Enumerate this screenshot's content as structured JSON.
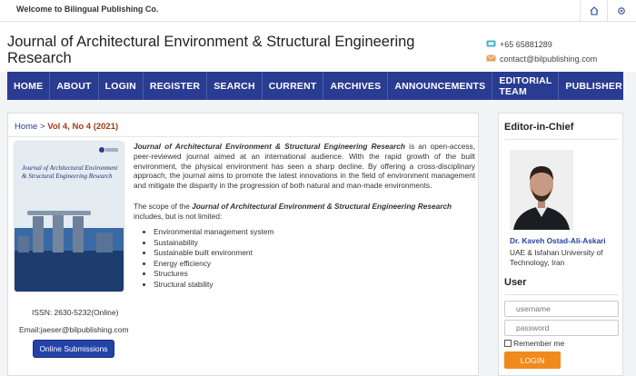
{
  "topbar": {
    "welcome": "Welcome to Bilingual Publishing Co.",
    "icons": [
      "home-icon",
      "gear-icon"
    ]
  },
  "header": {
    "journal_title": "Journal of Architectural Environment & Structural Engineering Research",
    "phone": "+65 65881289",
    "email": "contact@bilpublishing.com",
    "phone_icon": "phone-icon",
    "mail_icon": "mail-icon"
  },
  "nav": [
    "HOME",
    "ABOUT",
    "LOGIN",
    "REGISTER",
    "SEARCH",
    "CURRENT",
    "ARCHIVES",
    "ANNOUNCEMENTS",
    "EDITORIAL TEAM",
    "PUBLISHER"
  ],
  "breadcrumb": {
    "home": "Home",
    "separator": ">",
    "current": "Vol 4, No 4 (2021)"
  },
  "cover": {
    "title": "Journal of Architectural Environment & Structural Engineering Research"
  },
  "intro": {
    "journal_name": "Journal of Architectural Environment & Structural Engineering Research",
    "text": " is an open-access, peer-reviewed journal aimed at an international audience. With the rapid growth of the built environment, the physical environment has seen a sharp decline. By offering a cross-disciplinary approach, the journal aims to promote the latest innovations in the field of environment management and mitigate the disparity in the progression of both natural and man-made environments."
  },
  "scope": {
    "prefix": "The scope of the ",
    "journal_name": "Journal of Architectural Environment & Structural Engineering Research",
    "suffix": " includes, but is not limited:",
    "items": [
      "Environmental management system",
      "Sustainability",
      "Sustainable built environment",
      "Energy efficiency",
      "Structures",
      "Structural stability"
    ]
  },
  "issn": "ISSN: 2630-5232(Online)",
  "contact_email": "Email:jaeser@bilpublishing.com",
  "submit_label": "Online Submissions",
  "sidebar": {
    "editor_heading": "Editor-in-Chief",
    "editor_name": "Dr. Kaveh Ostad-Ali-Askari",
    "editor_affiliation": "UAE & Isfahan University of Technology, Iran",
    "user_heading": "User",
    "username_placeholder": "username",
    "password_placeholder": "password",
    "remember_label": "Remember me",
    "login_label": "LOGIN"
  }
}
